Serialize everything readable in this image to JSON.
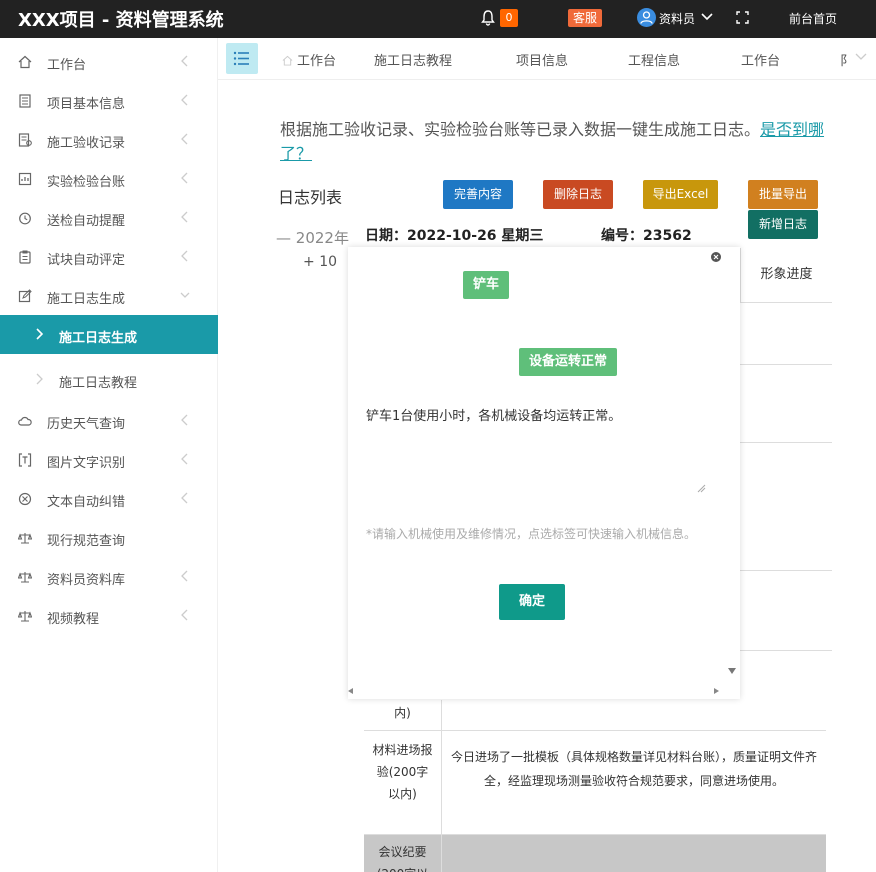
{
  "app": {
    "title": "XXX项目 - 资料管理系统",
    "notify_count": "0",
    "service_label": "客服",
    "user_name": "资料员",
    "front_label": "前台首页"
  },
  "sidebar": {
    "items": [
      {
        "label": "工作台",
        "icon": "home-icon"
      },
      {
        "label": "项目基本信息",
        "icon": "list-icon"
      },
      {
        "label": "施工验收记录",
        "icon": "doc-icon"
      },
      {
        "label": "实验检验台账",
        "icon": "report-icon"
      },
      {
        "label": "送检自动提醒",
        "icon": "clock-icon"
      },
      {
        "label": "试块自动评定",
        "icon": "clipboard-icon"
      },
      {
        "label": "施工日志生成",
        "icon": "edit-icon"
      },
      {
        "label": "施工日志生成",
        "icon": "arrow-icon"
      },
      {
        "label": "施工日志教程",
        "icon": "arrow-icon"
      },
      {
        "label": "历史天气查询",
        "icon": "cloud-icon"
      },
      {
        "label": "图片文字识别",
        "icon": "ocr-icon"
      },
      {
        "label": "文本自动纠错",
        "icon": "check-circle-icon"
      },
      {
        "label": "现行规范查询",
        "icon": "scale-icon"
      },
      {
        "label": "资料员资料库",
        "icon": "scale-icon"
      },
      {
        "label": "视频教程",
        "icon": "scale-icon"
      }
    ]
  },
  "tabs": [
    "工作台",
    "施工日志教程",
    "项目信息",
    "工程信息",
    "工作台",
    "阝"
  ],
  "main": {
    "intro_text": "根据施工验收记录、实验检验台账等已录入数据一键生成施工日志。",
    "intro_link": "是否到哪了？",
    "list_title": "日志列表",
    "buttons": {
      "complete": "完善内容",
      "delete": "删除日志",
      "export": "导出Excel",
      "batch_export": "批量导出",
      "new": "新增日志"
    },
    "tree_year": "2022年",
    "tree_month": "10",
    "date_label": "日期：2022-10-26 星期三",
    "code_label": "编号：23562",
    "table_header": "形象进度",
    "rows": [
      {
        "label": "内)",
        "value": ""
      },
      {
        "label": "材料进场报验(200字以内)",
        "value": "今日进场了一批模板（具体规格数量详见材料台账），质量证明文件齐全，经监理现场测量验收符合规范要求，同意进场使用。"
      },
      {
        "label": "会议纪要(200字以",
        "value": ""
      }
    ]
  },
  "modal": {
    "chip1": "铲车",
    "chip2": "设备运转正常",
    "text": "铲车1台使用小时，各机械设备均运转正常。",
    "hint": "*请输入机械使用及维修情况，点选标签可快速输入机械信息。",
    "ok": "确定"
  },
  "colors": {
    "accent": "#1a9aa8",
    "btn_blue": "#1f78c4",
    "btn_red": "#c94a22",
    "btn_yellow": "#c8970c",
    "btn_orange": "#d1801f",
    "btn_teal": "#126f63"
  }
}
